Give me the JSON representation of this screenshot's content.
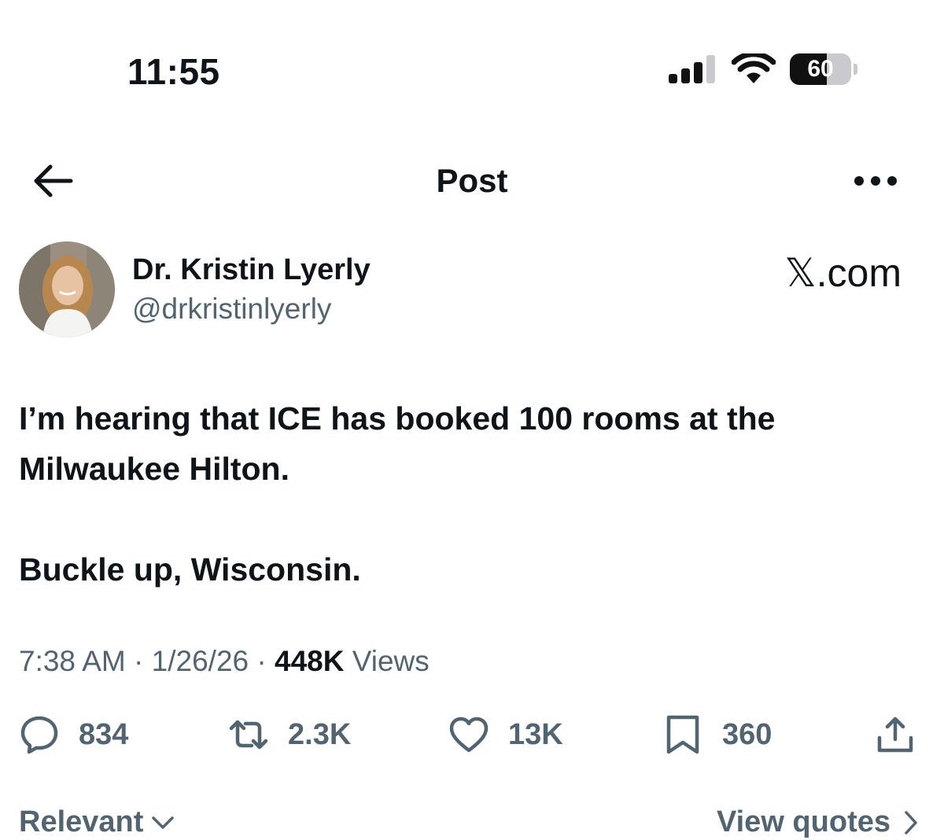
{
  "status_bar": {
    "time": "11:55",
    "battery_level": "60",
    "battery_fraction": 0.6,
    "signal_bars_active": 3,
    "signal_bars_total": 4,
    "icons": [
      "cellular-signal-icon",
      "wifi-icon",
      "battery-icon"
    ]
  },
  "header": {
    "title": "Post",
    "back_icon": "arrow-left-icon",
    "more_icon": "more-horizontal-icon"
  },
  "author": {
    "name": "Dr. Kristin Lyerly",
    "handle": "@drkristinlyerly",
    "source": "𝕏.com"
  },
  "post": {
    "paragraphs": [
      "I’m hearing that ICE has booked 100 rooms at the Milwaukee Hilton.",
      "Buckle up, Wisconsin."
    ],
    "time": "7:38 AM",
    "date": "1/26/26",
    "views_count": "448K",
    "views_label": "Views",
    "separator": "·"
  },
  "actions": {
    "replies": "834",
    "reposts": "2.3K",
    "likes": "13K",
    "bookmarks": "360"
  },
  "footer": {
    "sort_label": "Relevant",
    "view_quotes": "View quotes"
  },
  "colors": {
    "text_primary": "#0f1419",
    "text_secondary": "#536471",
    "background": "#ffffff"
  }
}
